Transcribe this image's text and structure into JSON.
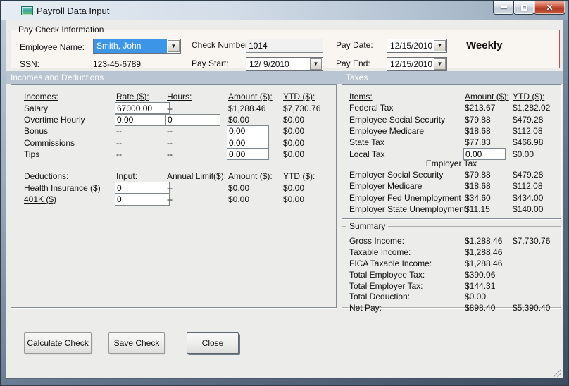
{
  "window": {
    "title": "Payroll Data Input"
  },
  "icons": {
    "dropdown": "▼",
    "close": "✕"
  },
  "paycheck": {
    "legend": "Pay Check Information",
    "employee_name": {
      "label": "Employee Name:",
      "value": "Smith, John"
    },
    "ssn": {
      "label": "SSN:",
      "value": "123-45-6789"
    },
    "check_number": {
      "label": "Check Number:",
      "value": "1014"
    },
    "pay_start": {
      "label": "Pay Start:",
      "value": "12/ 9/2010"
    },
    "pay_date": {
      "label": "Pay Date:",
      "value": "12/15/2010"
    },
    "pay_end": {
      "label": "Pay End:",
      "value": "12/15/2010"
    },
    "frequency": "Weekly"
  },
  "section_headers": {
    "left": "Incomes and Deductions",
    "right": "Taxes"
  },
  "incomes": {
    "headers": {
      "item": "Incomes:",
      "rate": "Rate ($):",
      "hours": "Hours:",
      "amount": "Amount ($):",
      "ytd": "YTD ($):"
    },
    "rows": [
      {
        "label": "Salary",
        "rate": "67000.00",
        "hours": "--",
        "amount": "$1,288.46",
        "ytd": "$7,730.76"
      },
      {
        "label": "Overtime Hourly",
        "rate": "0.00",
        "hours": "0",
        "amount": "$0.00",
        "ytd": "$0.00"
      },
      {
        "label": "Bonus",
        "rate": "--",
        "hours": "--",
        "amount": "0.00",
        "ytd": "$0.00"
      },
      {
        "label": "Commissions",
        "rate": "--",
        "hours": "--",
        "amount": "0.00",
        "ytd": "$0.00"
      },
      {
        "label": "Tips",
        "rate": "--",
        "hours": "--",
        "amount": "0.00",
        "ytd": "$0.00"
      }
    ]
  },
  "deductions": {
    "headers": {
      "item": "Deductions:",
      "input": "Input:",
      "annual_limit": "Annual Limit($):",
      "amount": "Amount ($):",
      "ytd": "YTD ($):"
    },
    "rows": [
      {
        "label": "Health Insurance  ($)",
        "input": "0",
        "annual_limit": "--",
        "amount": "$0.00",
        "ytd": "$0.00"
      },
      {
        "label": "401K  ($)",
        "input": "0",
        "annual_limit": "--",
        "amount": "$0.00",
        "ytd": "$0.00"
      }
    ]
  },
  "taxes": {
    "headers": {
      "item": "Items:",
      "amount": "Amount ($):",
      "ytd": "YTD ($):"
    },
    "employee_rows": [
      {
        "label": "Federal Tax",
        "amount": "$213.67",
        "ytd": "$1,282.02"
      },
      {
        "label": "Employee Social Security",
        "amount": "$79.88",
        "ytd": "$479.28"
      },
      {
        "label": "Employee Medicare",
        "amount": "$18.68",
        "ytd": "$112.08"
      },
      {
        "label": "State Tax",
        "amount": "$77.83",
        "ytd": "$466.98"
      },
      {
        "label": "Local Tax",
        "amount": "0.00",
        "ytd": "$0.00"
      }
    ],
    "employer_header": "Employer Tax",
    "employer_rows": [
      {
        "label": "Employer Social Security",
        "amount": "$79.88",
        "ytd": "$479.28"
      },
      {
        "label": "Employer Medicare",
        "amount": "$18.68",
        "ytd": "$112.08"
      },
      {
        "label": "Employer Fed Unemployment",
        "amount": "$34.60",
        "ytd": "$434.00"
      },
      {
        "label": "Employer State Unemployment",
        "amount": "$11.15",
        "ytd": "$140.00"
      }
    ]
  },
  "summary": {
    "legend": "Summary",
    "rows": [
      {
        "label": "Gross Income:",
        "amount": "$1,288.46",
        "ytd": "$7,730.76"
      },
      {
        "label": "Taxable Income:",
        "amount": "$1,288.46",
        "ytd": ""
      },
      {
        "label": "FICA Taxable Income:",
        "amount": "$1,288.46",
        "ytd": ""
      },
      {
        "label": "Total Employee Tax:",
        "amount": "$390.06",
        "ytd": ""
      },
      {
        "label": "Total Employer Tax:",
        "amount": "$144.31",
        "ytd": ""
      },
      {
        "label": "Total Deduction:",
        "amount": "$0.00",
        "ytd": ""
      },
      {
        "label": "Net Pay:",
        "amount": "$898.40",
        "ytd": "$5,390.40"
      }
    ]
  },
  "buttons": {
    "calculate": "Calculate Check",
    "save": "Save Check",
    "close": "Close"
  }
}
